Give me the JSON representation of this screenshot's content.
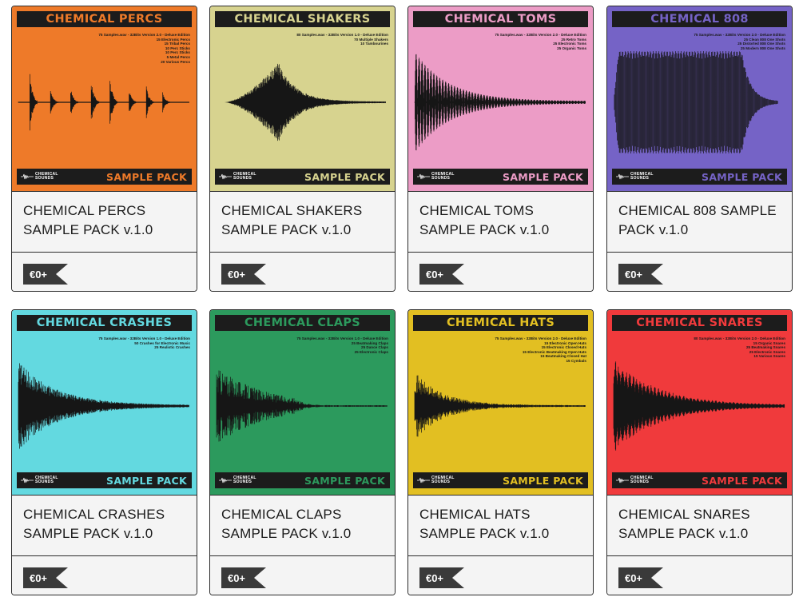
{
  "brand": {
    "line1": "CHEMICAL",
    "line2": "SOUNDS"
  },
  "products": [
    {
      "cover_title": "CHEMICAL PERCS",
      "cover_bg": "#ee7a29",
      "title_color": "#ee7a29",
      "cover_lines": [
        "75 Samples.wav - 32Bits Version 2.0 - Deluxe Edition",
        "15 Electronic Percs",
        "15 Tribal Percs",
        "10 Perc Sticks",
        "10 Perc Sticks",
        "5 Metal Percs",
        "20 Various Percs"
      ],
      "wave": "percs",
      "footer_label": "SAMPLE PACK",
      "title": "CHEMICAL PERCS SAMPLE PACK v.1.0",
      "price": "€0+"
    },
    {
      "cover_title": "CHEMICAL SHAKERS",
      "cover_bg": "#d7d38f",
      "title_color": "#d7d38f",
      "cover_lines": [
        "80 Samples.wav - 32Bits Version 1.0 - Deluxe Edition",
        "70 Multiple Shakers",
        "10 Tambourines"
      ],
      "wave": "shakers",
      "footer_label": "SAMPLE PACK",
      "title": "CHEMICAL SHAKERS SAMPLE PACK v.1.0",
      "price": "€0+"
    },
    {
      "cover_title": "CHEMICAL TOMS",
      "cover_bg": "#ec9cc6",
      "title_color": "#ec9cc6",
      "cover_lines": [
        "75 Samples.wav - 32Bits Version 2.0 - Deluxe Edition",
        "25 Retro Toms",
        "25 Electronic Toms",
        "25 Organic Toms"
      ],
      "wave": "toms",
      "footer_label": "SAMPLE PACK",
      "title": "CHEMICAL TOMS SAMPLE PACK v.1.0",
      "price": "€0+"
    },
    {
      "cover_title": "CHEMICAL 808",
      "cover_bg": "#7563c6",
      "title_color": "#7563c6",
      "cover_lines": [
        "75 Samples.wav - 32Bits Version 2.0 - Deluxe Edition",
        "25 Clean 808 One Shots",
        "25 Distorted 808 One Shots",
        "25 Modern 808 One Shots"
      ],
      "wave": "808",
      "footer_label": "SAMPLE PACK",
      "title": "CHEMICAL 808 SAMPLE PACK v.1.0",
      "price": "€0+"
    },
    {
      "cover_title": "CHEMICAL CRASHES",
      "cover_bg": "#63d9e0",
      "title_color": "#63d9e0",
      "cover_lines": [
        "75 Samples.wav - 32Bits Version 1.0 - Deluxe Edition",
        "50 Crashes for Electronic Music",
        "25 Realistic Crashes"
      ],
      "wave": "crashes",
      "footer_label": "SAMPLE PACK",
      "title": "CHEMICAL CRASHES SAMPLE PACK v.1.0",
      "price": "€0+"
    },
    {
      "cover_title": "CHEMICAL CLAPS",
      "cover_bg": "#2c9a5d",
      "title_color": "#2c9a5d",
      "cover_lines": [
        "75 Samples.wav - 32Bits Version 1.0 - Deluxe Edition",
        "25 Beatmaking Claps",
        "25 Dance Claps",
        "25 Electronic Claps"
      ],
      "wave": "claps",
      "footer_label": "SAMPLE PACK",
      "title": "CHEMICAL CLAPS SAMPLE PACK v.1.0",
      "price": "€0+"
    },
    {
      "cover_title": "CHEMICAL HATS",
      "cover_bg": "#e2bf22",
      "title_color": "#e2bf22",
      "cover_lines": [
        "75 Samples.wav - 32Bits Version 2.0 - Deluxe Edition",
        "15 Electronic Open Hats",
        "15 Electronic Closed Hats",
        "15 Electronic Beatmaking Open Hats",
        "15 Beatmaking Closed Hat",
        "15 Cymbals"
      ],
      "wave": "hats",
      "footer_label": "SAMPLE PACK",
      "title": "CHEMICAL HATS SAMPLE PACK v.1.0",
      "price": "€0+"
    },
    {
      "cover_title": "CHEMICAL SNARES",
      "cover_bg": "#f03a3c",
      "title_color": "#f03a3c",
      "cover_lines": [
        "80 Samples.wav - 32Bits Version 2.0 - Deluxe Edition",
        "15 Organic Snares",
        "25 Beatmaking Snares",
        "25 Electronic Snares",
        "15 Various Snares"
      ],
      "wave": "snares",
      "footer_label": "SAMPLE PACK",
      "title": "CHEMICAL SNARES SAMPLE PACK v.1.0",
      "price": "€0+"
    }
  ]
}
